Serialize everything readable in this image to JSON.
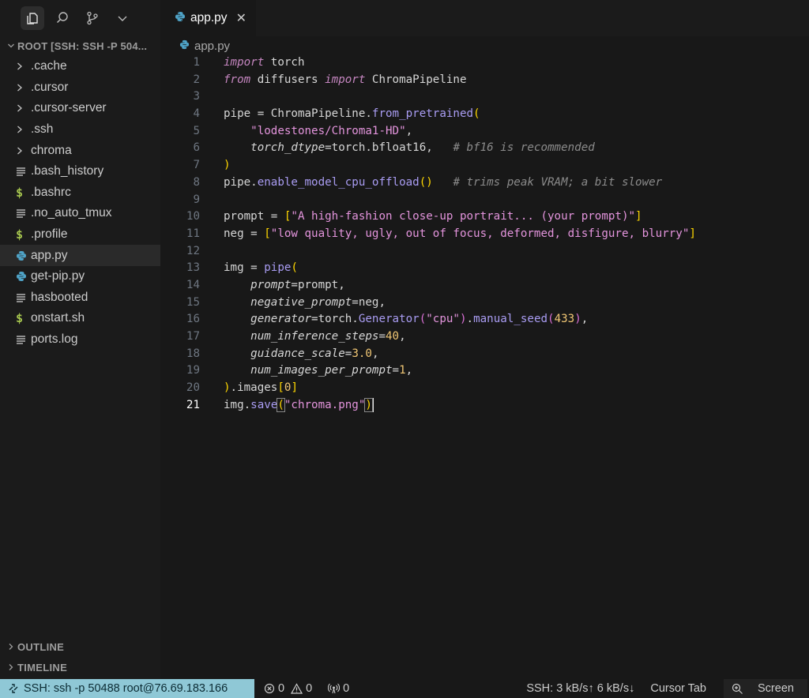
{
  "explorer": {
    "root_label": "ROOT [SSH: SSH -P 504...",
    "items": [
      {
        "label": ".cache",
        "kind": "folder"
      },
      {
        "label": ".cursor",
        "kind": "folder"
      },
      {
        "label": ".cursor-server",
        "kind": "folder"
      },
      {
        "label": ".ssh",
        "kind": "folder"
      },
      {
        "label": "chroma",
        "kind": "folder"
      },
      {
        "label": ".bash_history",
        "kind": "text"
      },
      {
        "label": ".bashrc",
        "kind": "shell"
      },
      {
        "label": ".no_auto_tmux",
        "kind": "text"
      },
      {
        "label": ".profile",
        "kind": "shell"
      },
      {
        "label": "app.py",
        "kind": "python",
        "selected": true
      },
      {
        "label": "get-pip.py",
        "kind": "python"
      },
      {
        "label": "hasbooted",
        "kind": "text"
      },
      {
        "label": "onstart.sh",
        "kind": "shell"
      },
      {
        "label": "ports.log",
        "kind": "text"
      }
    ],
    "outline_label": "OUTLINE",
    "timeline_label": "TIMELINE"
  },
  "tab": {
    "label": "app.py",
    "close": "✕"
  },
  "breadcrumb": {
    "file": "app.py"
  },
  "editor": {
    "current_line": 21,
    "line_numbers": [
      "1",
      "2",
      "3",
      "4",
      "5",
      "6",
      "7",
      "8",
      "9",
      "10",
      "11",
      "12",
      "13",
      "14",
      "15",
      "16",
      "17",
      "18",
      "19",
      "20",
      "21"
    ]
  },
  "statusbar": {
    "remote": "SSH: ssh -p 50488 root@76.69.183.166",
    "errors": "0",
    "warnings": "0",
    "ports": "0",
    "ssh_traffic": "SSH: 3 kB/s↑ 6 kB/s↓",
    "cursor_tab": "Cursor Tab",
    "screen": "Screen"
  },
  "colors": {
    "remote_bg": "#8fc8d6",
    "keyword": "#c586c0",
    "function": "#a99cf2",
    "string": "#e394dc",
    "number": "#f0c674",
    "comment": "#8b8b8b",
    "python_icon": "#4fa3c7",
    "shell_icon": "#a6c64f"
  }
}
